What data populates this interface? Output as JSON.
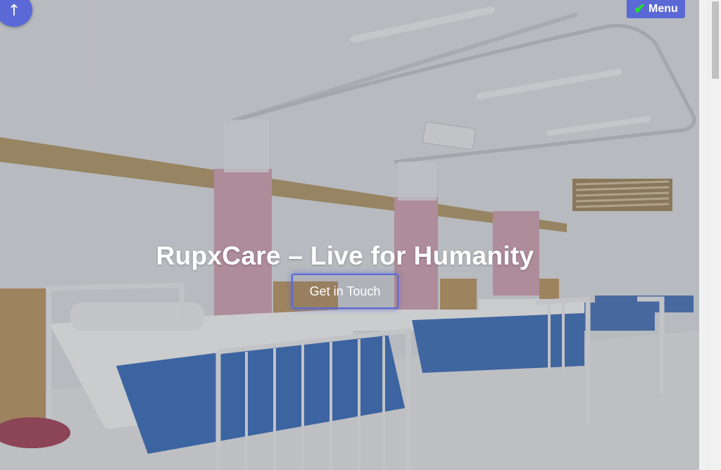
{
  "hero": {
    "headline": "RupxCare – Live for Humanity",
    "cta_label": "Get in Touch"
  },
  "nav": {
    "menu_label": "Menu",
    "menu_icon": "checkmark-icon"
  },
  "back_to_top": {
    "glyph": "↑"
  },
  "colors": {
    "accent": "#5b69d6",
    "check": "#22e22a"
  }
}
